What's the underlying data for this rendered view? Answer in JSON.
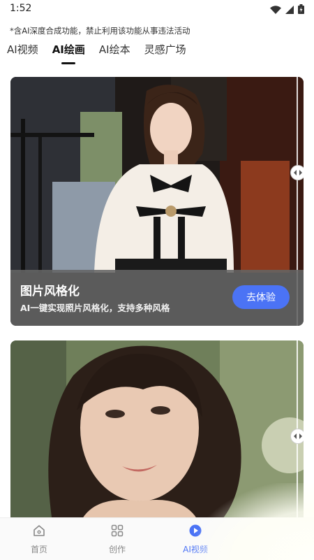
{
  "status_bar": {
    "time": "1:52"
  },
  "notice": "*含AI深度合成功能，禁止利用该功能从事违法活动",
  "tabs": [
    {
      "label": "AI视频",
      "active": false
    },
    {
      "label": "AI绘画",
      "active": true
    },
    {
      "label": "AI绘本",
      "active": false
    },
    {
      "label": "灵感广场",
      "active": false
    }
  ],
  "cards": [
    {
      "title": "图片风格化",
      "description": "AI一键实现照片风格化，支持多种风格",
      "button_label": "去体验"
    }
  ],
  "bottom_nav": [
    {
      "label": "首页",
      "icon": "home-icon",
      "active": false
    },
    {
      "label": "创作",
      "icon": "grid-icon",
      "active": false
    },
    {
      "label": "AI视频",
      "icon": "play-icon",
      "active": true
    }
  ],
  "colors": {
    "accent": "#4b73f5",
    "card_overlay": "#646464"
  }
}
